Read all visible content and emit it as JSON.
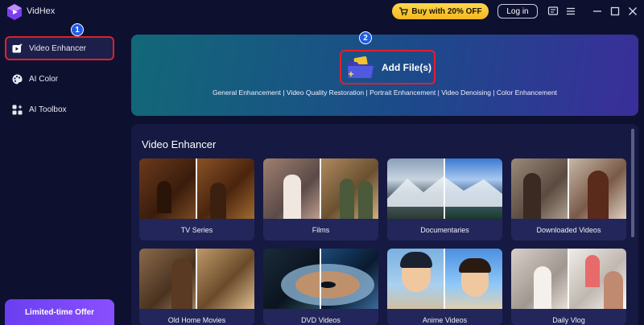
{
  "app": {
    "name": "VidHex"
  },
  "header": {
    "buy_label": "Buy with 20% OFF",
    "login_label": "Log in"
  },
  "sidebar": {
    "items": [
      {
        "label": "Video Enhancer",
        "icon": "video-enhancer-icon",
        "active": true
      },
      {
        "label": "AI Color",
        "icon": "palette-icon",
        "active": false
      },
      {
        "label": "AI Toolbox",
        "icon": "toolbox-icon",
        "active": false
      }
    ],
    "offer_label": "Limited-time Offer"
  },
  "steps": {
    "one": "1",
    "two": "2"
  },
  "upload": {
    "button_label": "Add File(s)",
    "features": "General Enhancement | Video Quality Restoration | Portrait Enhancement | Video Denoising | Color Enhancement"
  },
  "enhancer": {
    "title": "Video Enhancer",
    "cards": [
      {
        "label": "TV Series"
      },
      {
        "label": "Films"
      },
      {
        "label": "Documentaries"
      },
      {
        "label": "Downloaded Videos"
      },
      {
        "label": "Old Home Movies"
      },
      {
        "label": "DVD Videos"
      },
      {
        "label": "Anime Videos"
      },
      {
        "label": "Daily Vlog"
      }
    ]
  },
  "colors": {
    "background": "#0e1030",
    "accent_highlight": "#e0202a",
    "buy_button": "#f5b820",
    "step_badge": "#1d5ce6",
    "offer_button": "#7a48f8"
  }
}
